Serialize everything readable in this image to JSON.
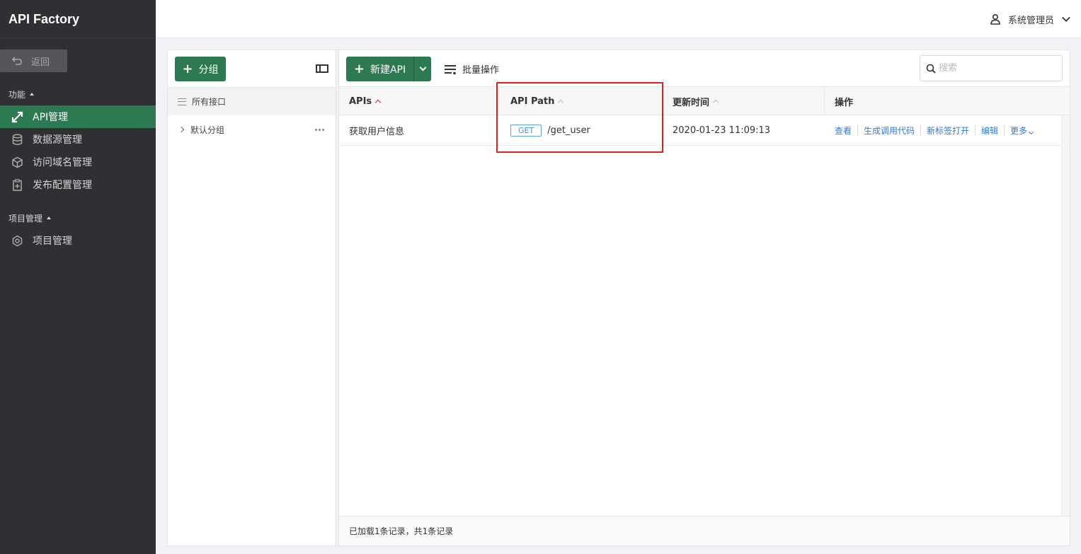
{
  "app": {
    "title": "API Factory"
  },
  "sidebar": {
    "back_label": "返回",
    "sections": [
      {
        "title": "功能",
        "items": [
          {
            "label": "API管理",
            "icon": "share-arrow-icon",
            "active": true
          },
          {
            "label": "数据源管理",
            "icon": "database-icon"
          },
          {
            "label": "访问域名管理",
            "icon": "cube-icon"
          },
          {
            "label": "发布配置管理",
            "icon": "clipboard-icon"
          }
        ]
      },
      {
        "title": "项目管理",
        "items": [
          {
            "label": "项目管理",
            "icon": "gear-icon"
          }
        ]
      }
    ]
  },
  "header": {
    "user_name": "系统管理员"
  },
  "groups": {
    "add_label": "分组",
    "all_label": "所有接口",
    "items": [
      {
        "label": "默认分组"
      }
    ]
  },
  "toolbar": {
    "new_api_label": "新建API",
    "batch_label": "批量操作",
    "search_placeholder": "搜索"
  },
  "table": {
    "columns": [
      "APIs",
      "API Path",
      "更新时间",
      "操作"
    ],
    "rows": [
      {
        "name": "获取用户信息",
        "method": "GET",
        "path": "/get_user",
        "updated": "2020-01-23 11:09:13",
        "actions": [
          "查看",
          "生成调用代码",
          "新标签打开",
          "编辑",
          "更多"
        ]
      }
    ],
    "footer": "已加载1条记录，共1条记录"
  },
  "colors": {
    "accent": "#2d7a52",
    "sidebar": "#2f3033",
    "link": "#2f7bd6",
    "highlight": "#e02020"
  }
}
